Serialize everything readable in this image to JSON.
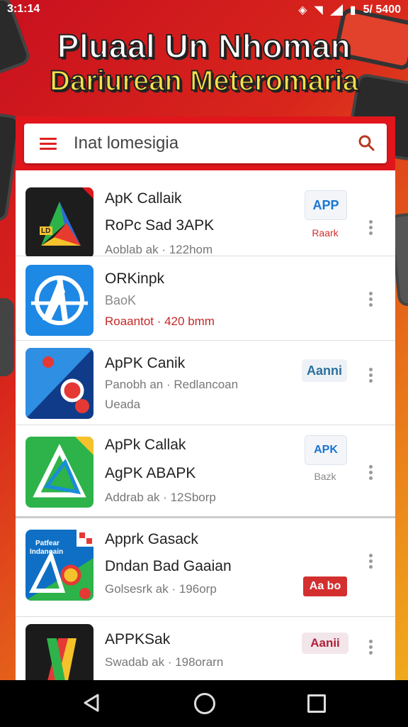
{
  "status": {
    "time": "3:1:14",
    "battery": "5/ 5400"
  },
  "banner": {
    "line1": "Pluaal Un Nhoman",
    "line2": "Dariurean Meteromaria"
  },
  "search": {
    "value": "Inat lomesigia"
  },
  "apps": [
    {
      "line1": "ApK Callaik",
      "line2": "RoPc Sad 3APK",
      "line3": "Aoblab ak · 122hom",
      "badge": "APP",
      "sublabel": "Raark"
    },
    {
      "line1": "ORKinpk",
      "line2": "BaoK",
      "line3": "Roaantot · 420 bmm"
    },
    {
      "line1": "ApPK Canik",
      "line2": "Panobh an · Redlancoan",
      "line3": "Ueada",
      "badge": "Aanni"
    },
    {
      "line1": "ApPk Callak",
      "line2": "AgPK ABAPK",
      "line3": "Addrab ak · 12Sborp",
      "badge": "APK",
      "sublabel": "Bazk"
    },
    {
      "line1": "Apprk Gasack",
      "line2": "Dndan Bad Gaaian",
      "line3": "Golsesrk ak · 196orp",
      "badge": "Aa bo",
      "icon_label_1": "Patfear",
      "icon_label_2": "Indanoain"
    },
    {
      "line1": "APPKSak",
      "line3": "Swadab ak · 198orarn",
      "badge": "Aanii"
    }
  ],
  "icon_labels": {
    "app1": "LD"
  },
  "colors": {
    "accent": "#e0161c",
    "badge_blue": "#1976d2",
    "badge_red": "#d32f2f"
  }
}
